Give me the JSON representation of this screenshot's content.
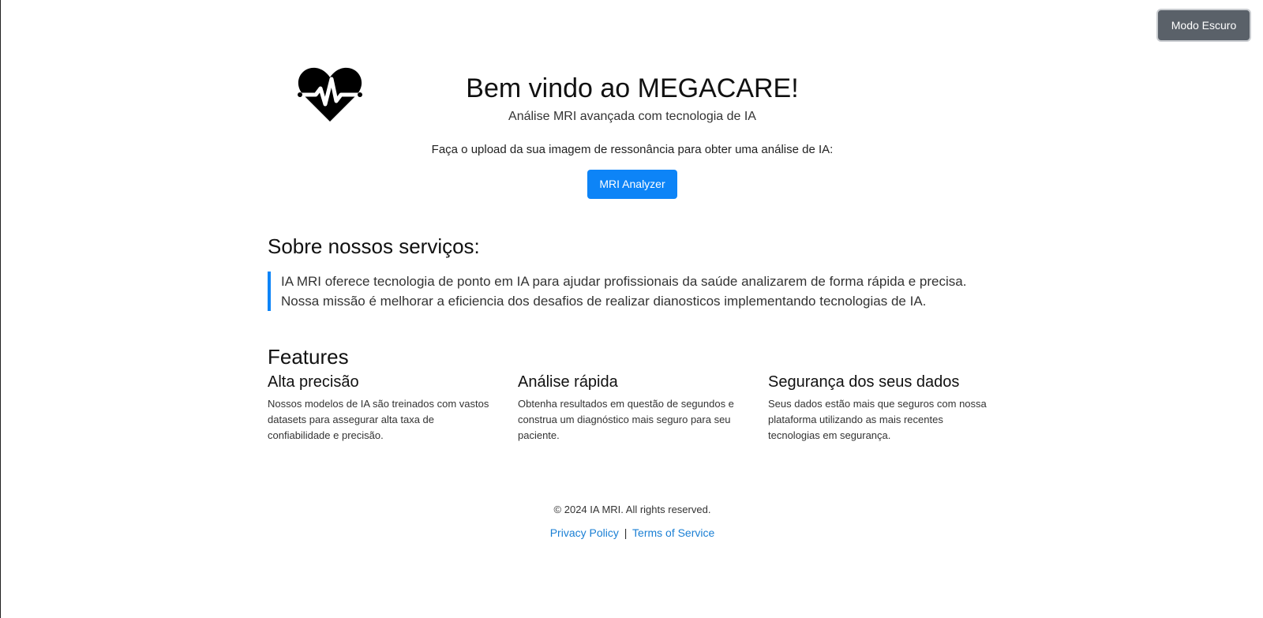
{
  "theme_toggle": {
    "label": "Modo Escuro"
  },
  "logo": {
    "icon": "heart-pulse-icon"
  },
  "hero": {
    "title": "Bem vindo ao MEGACARE!",
    "subtitle": "Análise MRI avançada com tecnologia de IA",
    "upload_text": "Faça o upload da sua imagem de ressonância para obter uma análise de IA:",
    "button_label": "MRI Analyzer"
  },
  "about": {
    "heading": "Sobre nossos serviços:",
    "text": "IA MRI oferece tecnologia de ponto em IA para ajudar profissionais da saúde analizarem de forma rápida e precisa. Nossa missão é melhorar a eficiencia dos desafios de realizar dianosticos implementando tecnologias de IA."
  },
  "features": {
    "heading": "Features",
    "items": [
      {
        "title": "Alta precisão",
        "text": "Nossos modelos de IA são treinados com vastos datasets para assegurar alta taxa de confiabilidade e precisão."
      },
      {
        "title": "Análise rápida",
        "text": "Obtenha resultados em questão de segundos e construa um diagnóstico mais seguro para seu paciente."
      },
      {
        "title": "Segurança dos seus dados",
        "text": "Seus dados estão mais que seguros com nossa plataforma utilizando as mais recentes tecnologias em segurança."
      }
    ]
  },
  "footer": {
    "copyright": "© 2024 IA MRI. All rights reserved.",
    "privacy": "Privacy Policy",
    "separator": "|",
    "terms": "Terms of Service"
  },
  "colors": {
    "accent": "#0d84f7",
    "toggle_bg": "#5a6169",
    "link": "#1a7fd4"
  }
}
